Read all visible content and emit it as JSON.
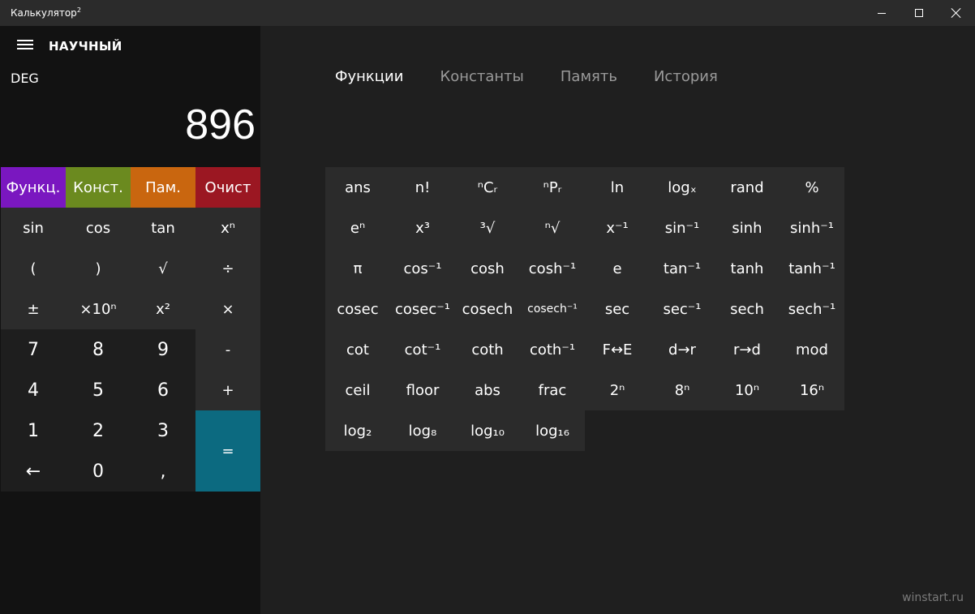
{
  "window": {
    "title": "Калькулятор",
    "title_sup": "2",
    "minimize_icon": "minimize-icon",
    "maximize_icon": "maximize-icon",
    "close_icon": "close-icon"
  },
  "header": {
    "mode": "НАУЧНЫЙ",
    "angle_mode": "DEG",
    "display_value": "896"
  },
  "category_buttons": [
    "Функц.",
    "Конст.",
    "Пам.",
    "Очист"
  ],
  "keypad": [
    [
      "sin",
      "cos",
      "tan",
      "xⁿ"
    ],
    [
      "(",
      ")",
      "√",
      "÷"
    ],
    [
      "±",
      "×10ⁿ",
      "x²",
      "×"
    ],
    [
      "7",
      "8",
      "9",
      "-"
    ],
    [
      "4",
      "5",
      "6",
      "+"
    ],
    [
      "1",
      "2",
      "3",
      "="
    ],
    [
      "←",
      "0",
      ","
    ]
  ],
  "tabs": [
    "Функции",
    "Константы",
    "Память",
    "История"
  ],
  "active_tab": "Функции",
  "functions": [
    [
      "ans",
      "n!",
      "ⁿCᵣ",
      "ⁿPᵣ",
      "ln",
      "logₓ",
      "rand",
      "%"
    ],
    [
      "eⁿ",
      "x³",
      "³√",
      "ⁿ√",
      "x⁻¹",
      "sin⁻¹",
      "sinh",
      "sinh⁻¹"
    ],
    [
      "π",
      "cos⁻¹",
      "cosh",
      "cosh⁻¹",
      "e",
      "tan⁻¹",
      "tanh",
      "tanh⁻¹"
    ],
    [
      "cosec",
      "cosec⁻¹",
      "cosech",
      "cosech⁻¹",
      "sec",
      "sec⁻¹",
      "sech",
      "sech⁻¹"
    ],
    [
      "cot",
      "cot⁻¹",
      "coth",
      "coth⁻¹",
      "F↔E",
      "d→r",
      "r→d",
      "mod"
    ],
    [
      "ceil",
      "floor",
      "abs",
      "frac",
      "2ⁿ",
      "8ⁿ",
      "10ⁿ",
      "16ⁿ"
    ],
    [
      "log₂",
      "log₈",
      "log₁₀",
      "log₁₆"
    ]
  ],
  "watermark": "winstart.ru",
  "colors": {
    "func": "#7a17c0",
    "const": "#6b8a1f",
    "mem": "#c9660f",
    "clear": "#9b1722",
    "equals": "#0c6a80"
  }
}
